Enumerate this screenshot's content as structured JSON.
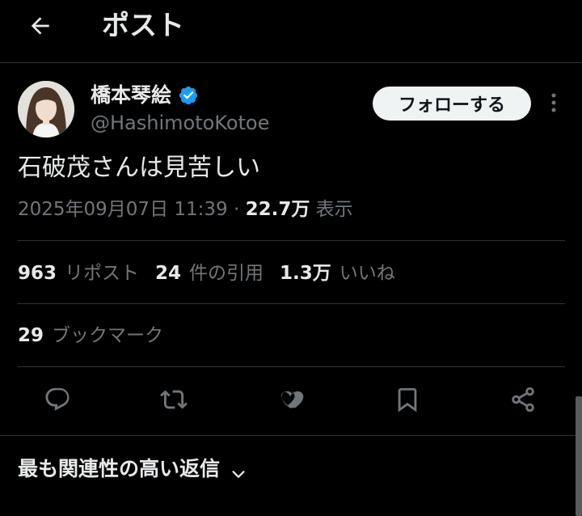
{
  "header": {
    "title": "ポスト",
    "back_icon": "arrow-left-icon"
  },
  "author": {
    "display_name": "橋本琴絵",
    "handle": "@HashimotoKotoe",
    "verified": true,
    "verified_color": "#1d9bf0"
  },
  "follow_button": {
    "label": "フォローする"
  },
  "tweet": {
    "text": "石破茂さんは見苦しい",
    "timestamp": "2025年09月07日 11:39",
    "separator": "·",
    "views_count": "22.7万",
    "views_label": "表示"
  },
  "stats": {
    "reposts": {
      "count": "963",
      "label": "リポスト"
    },
    "quotes": {
      "count": "24",
      "label": "件の引用"
    },
    "likes": {
      "count": "1.3万",
      "label": "いいね"
    },
    "bookmarks": {
      "count": "29",
      "label": "ブックマーク"
    }
  },
  "actions": [
    "reply-icon",
    "repost-icon",
    "like-icon",
    "bookmark-icon",
    "share-icon"
  ],
  "replies_sort": {
    "label": "最も関連性の高い返信"
  },
  "colors": {
    "background": "#000000",
    "text": "#e7e9ea",
    "muted": "#71767b",
    "divider": "#2f3336",
    "accent": "#1d9bf0"
  }
}
